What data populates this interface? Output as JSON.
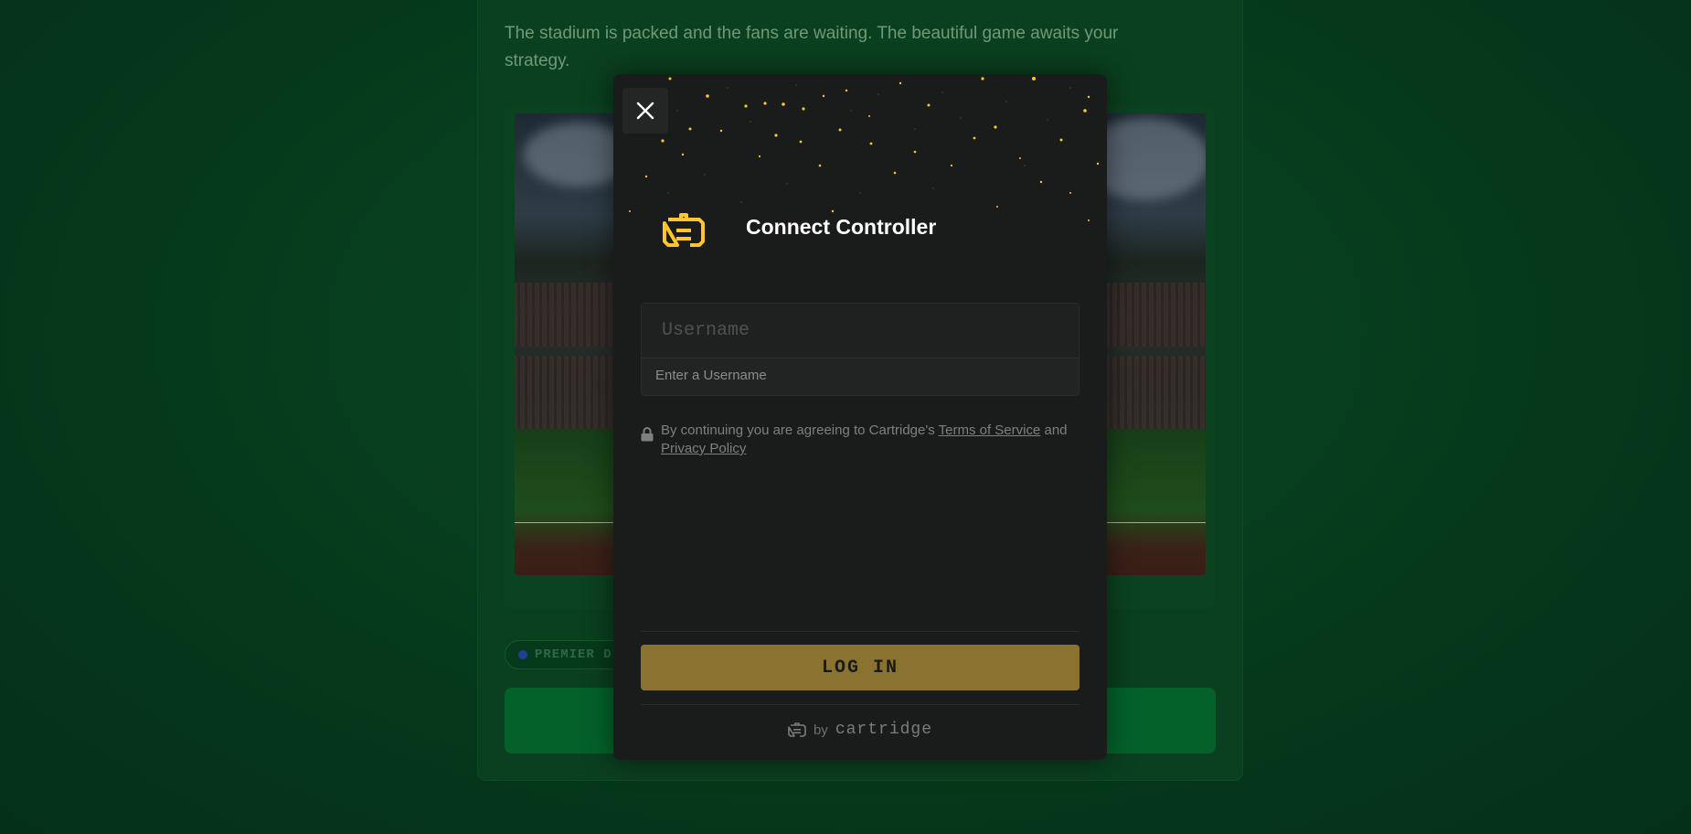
{
  "background": {
    "intro_text": "The stadium is packed and the fans are waiting. The beautiful game awaits your strategy.",
    "division_badge": "PREMIER DI"
  },
  "modal": {
    "title": "Connect Controller",
    "close_icon": "close-icon",
    "logo_icon": "controller-logo-icon",
    "username": {
      "placeholder": "Username",
      "value": "",
      "hint": "Enter a Username"
    },
    "terms": {
      "prefix": "By continuing you are agreeing to Cartridge's",
      "terms_link": "Terms of Service",
      "and": "and",
      "privacy_link": "Privacy Policy"
    },
    "login_label": "LOG IN",
    "footer": {
      "by": "by",
      "brand": "cartridge"
    }
  },
  "colors": {
    "accent": "#ffc52a",
    "login_button": "#8a7331",
    "modal_bg": "#1a1c1b",
    "page_bg": "#04331a"
  }
}
